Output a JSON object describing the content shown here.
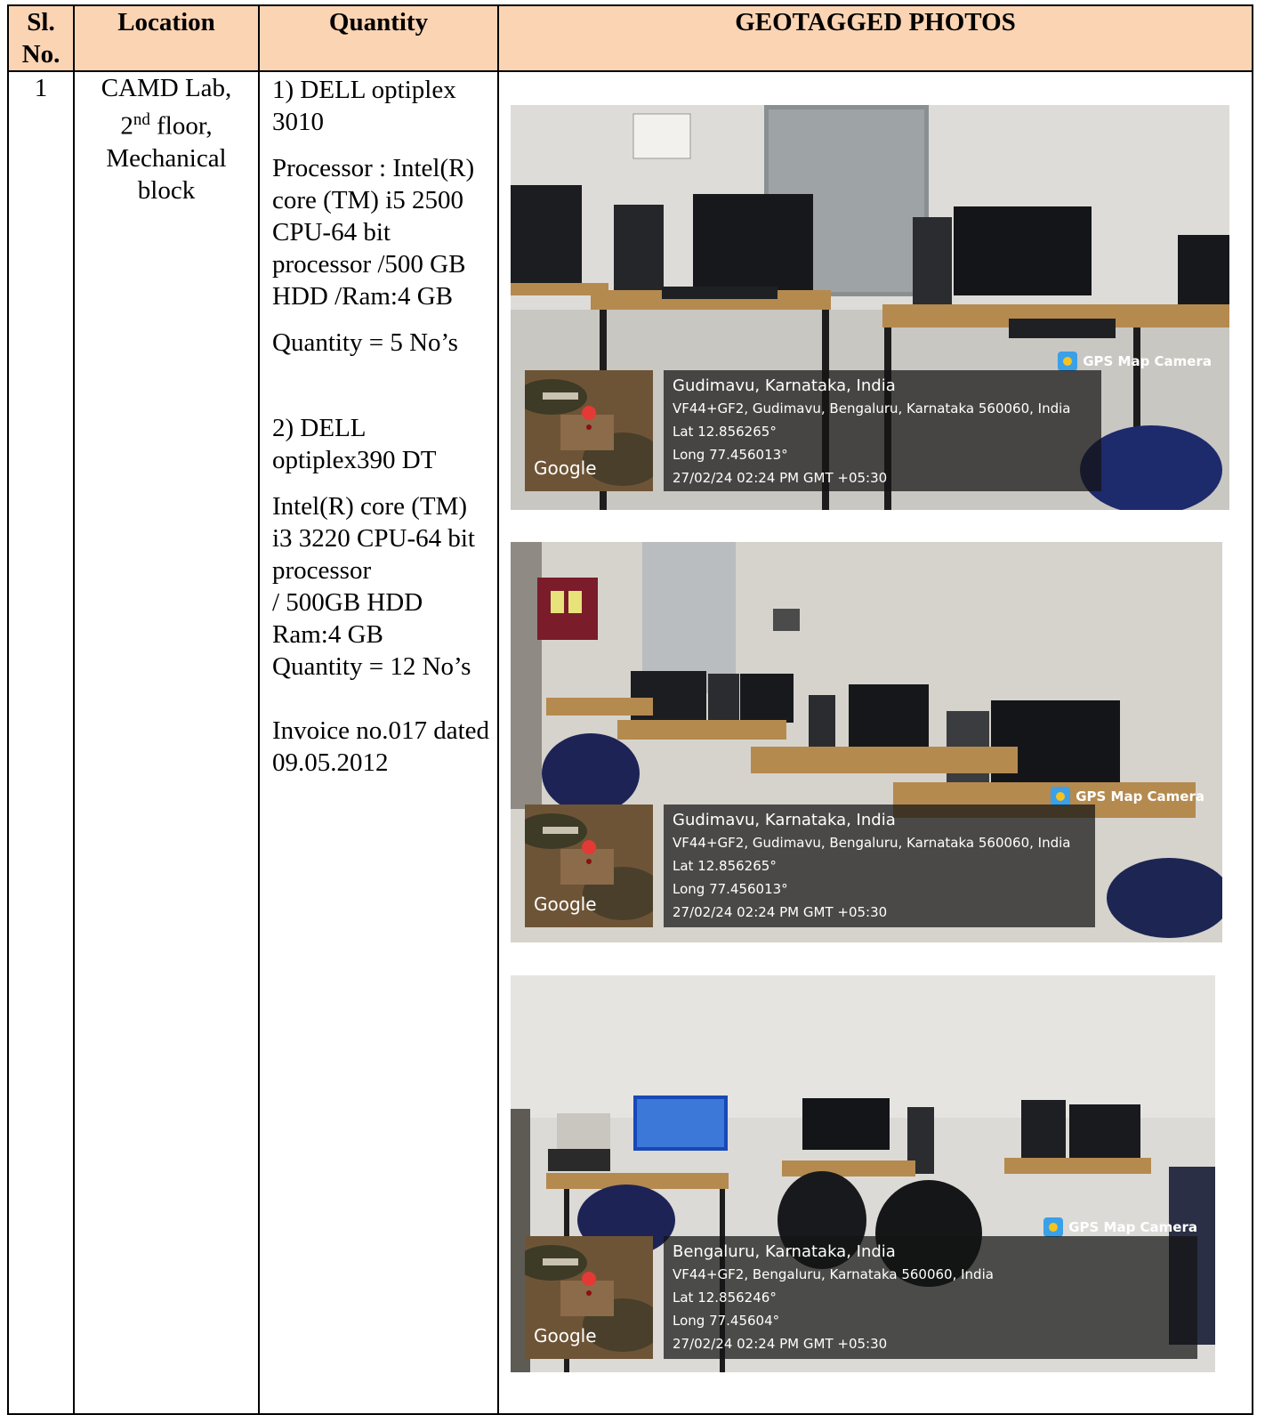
{
  "header": {
    "sl_no": "Sl. No.",
    "location": "Location",
    "quantity": "Quantity",
    "photos": "GEOTAGGED PHOTOS"
  },
  "row": {
    "sl": "1",
    "location_line1": "CAMD Lab,",
    "location_floor_num": "2",
    "location_floor_sup": "nd",
    "location_floor_rest": " floor,",
    "location_line3": "Mechanical",
    "location_line4": "block",
    "q1_title": "1) DELL optiplex 3010",
    "q1_processor": "Processor : Intel(R) core (TM) i5 2500 CPU-64 bit processor /500 GB HDD /Ram:4 GB",
    "q1_quantity": "Quantity = 5 No’s",
    "q2_title": "2) DELL optiplex390 DT",
    "q2_spec_1": "Intel(R) core (TM) i3 3220 CPU-64 bit processor",
    "q2_spec_2": "/ 500GB HDD",
    "q2_spec_3": "Ram:4 GB",
    "q2_quantity": "Quantity = 12 No’s",
    "invoice": "Invoice no.017 dated 09.05.2012"
  },
  "photos": [
    {
      "badge": "GPS Map Camera",
      "place": "Gudimavu, Karnataka, India",
      "address": "VF44+GF2, Gudimavu, Bengaluru, Karnataka 560060, India",
      "lat": "Lat 12.856265°",
      "long": "Long 77.456013°",
      "timestamp": "27/02/24 02:24 PM GMT +05:30",
      "map_label": "Google"
    },
    {
      "badge": "GPS Map Camera",
      "place": "Gudimavu, Karnataka, India",
      "address": "VF44+GF2, Gudimavu, Bengaluru, Karnataka 560060, India",
      "lat": "Lat 12.856265°",
      "long": "Long 77.456013°",
      "timestamp": "27/02/24 02:24 PM GMT +05:30",
      "map_label": "Google"
    },
    {
      "badge": "GPS Map Camera",
      "place": "Bengaluru, Karnataka, India",
      "address": "VF44+GF2, Bengaluru, Karnataka 560060, India",
      "lat": "Lat 12.856246°",
      "long": "Long 77.45604°",
      "timestamp": "27/02/24 02:24 PM GMT +05:30",
      "map_label": "Google"
    }
  ],
  "colors": {
    "header_bg": "#fbd4b4",
    "overlay_bg": "#1e1e1e",
    "map_pin": "#e53935"
  }
}
